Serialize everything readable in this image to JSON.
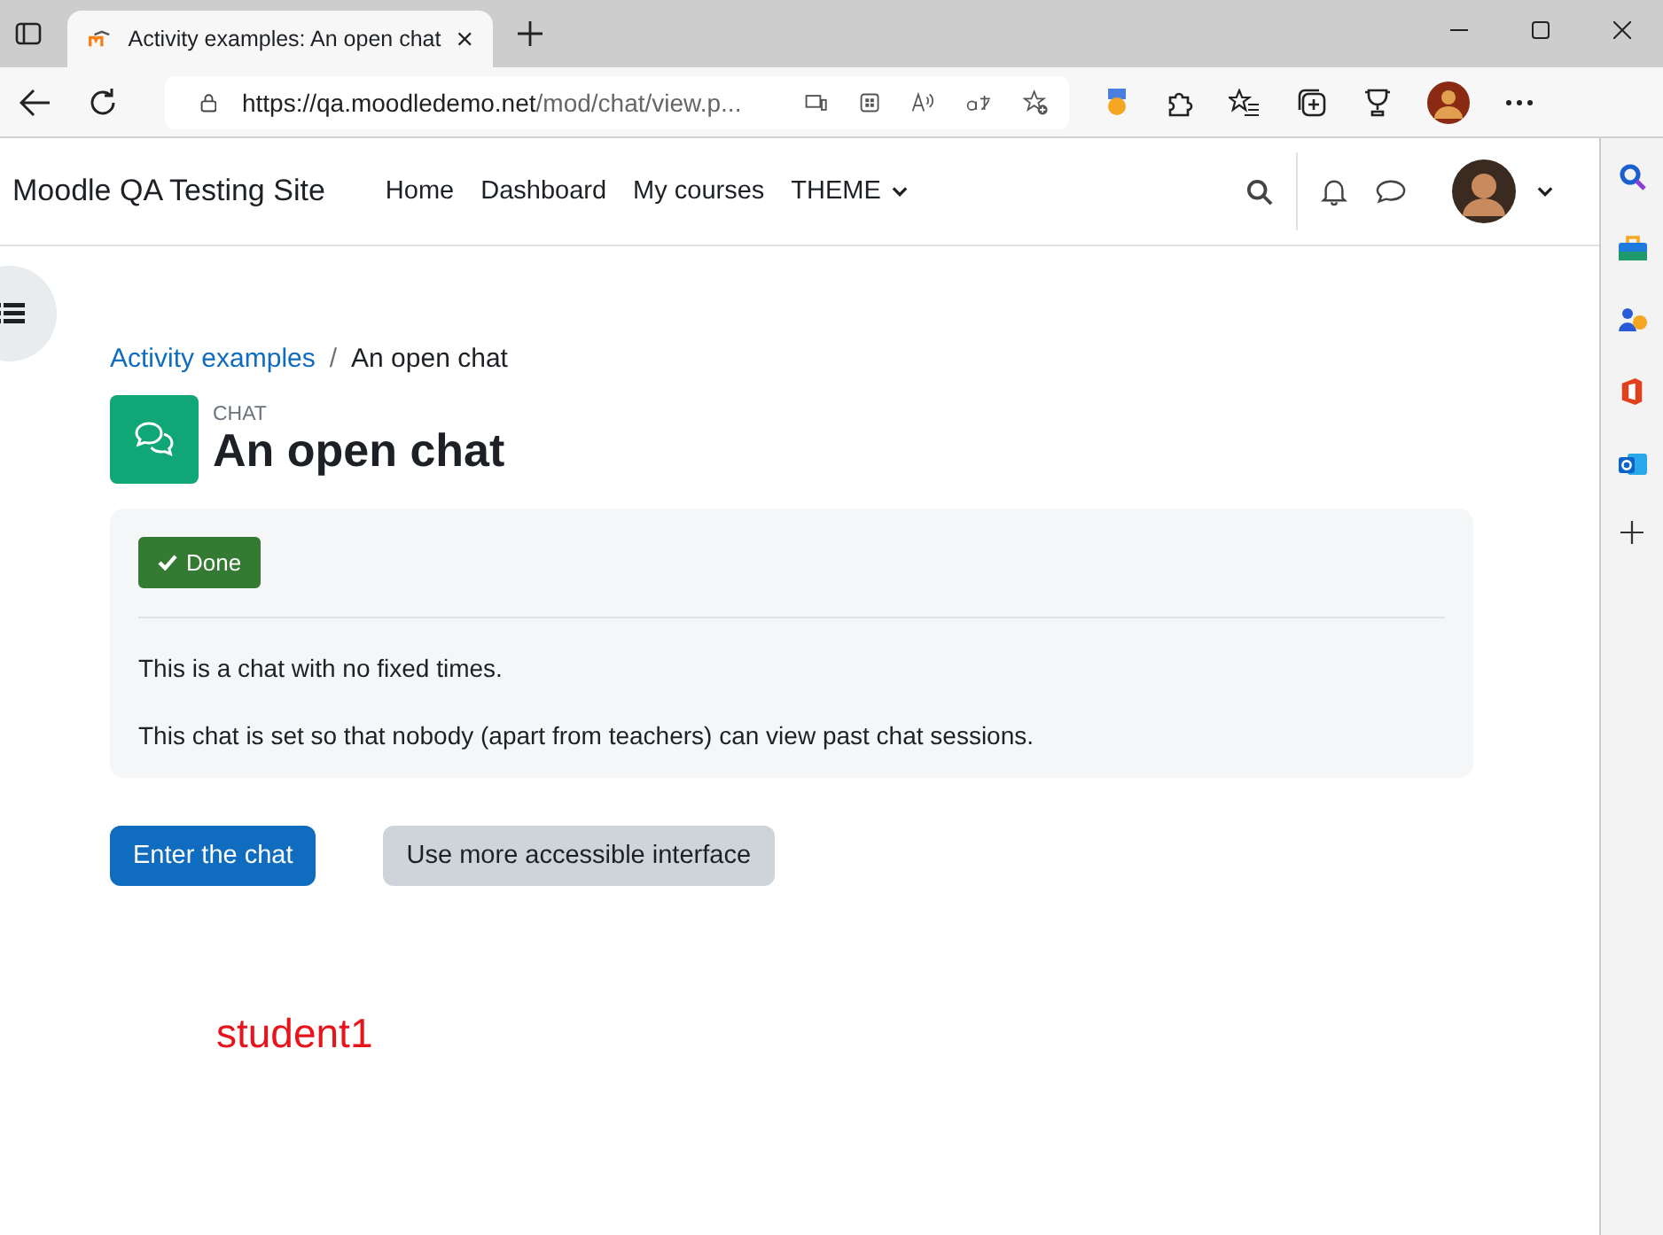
{
  "browser": {
    "tab_title": "Activity examples: An open chat",
    "url_host": "https://qa.moodledemo.net",
    "url_path": "/mod/chat/view.p..."
  },
  "navbar": {
    "site_name": "Moodle QA Testing Site",
    "items": [
      {
        "label": "Home",
        "dropdown": false
      },
      {
        "label": "Dashboard",
        "dropdown": false
      },
      {
        "label": "My courses",
        "dropdown": false
      },
      {
        "label": "THEME",
        "dropdown": true
      }
    ]
  },
  "breadcrumb": {
    "separator": "/",
    "items": [
      {
        "label": "Activity examples",
        "link": true
      },
      {
        "label": "An open chat",
        "link": false
      }
    ]
  },
  "activity": {
    "type": "CHAT",
    "title": "An open chat"
  },
  "completion": {
    "label": "Done",
    "done": true
  },
  "description": [
    "This is a chat with no fixed times.",
    "This chat is set so that nobody (apart from teachers) can view past chat sessions."
  ],
  "buttons": [
    {
      "label": "Enter the chat",
      "kind": "primary"
    },
    {
      "label": "Use more accessible interface",
      "kind": "secondary"
    }
  ],
  "user_label": "student1"
}
